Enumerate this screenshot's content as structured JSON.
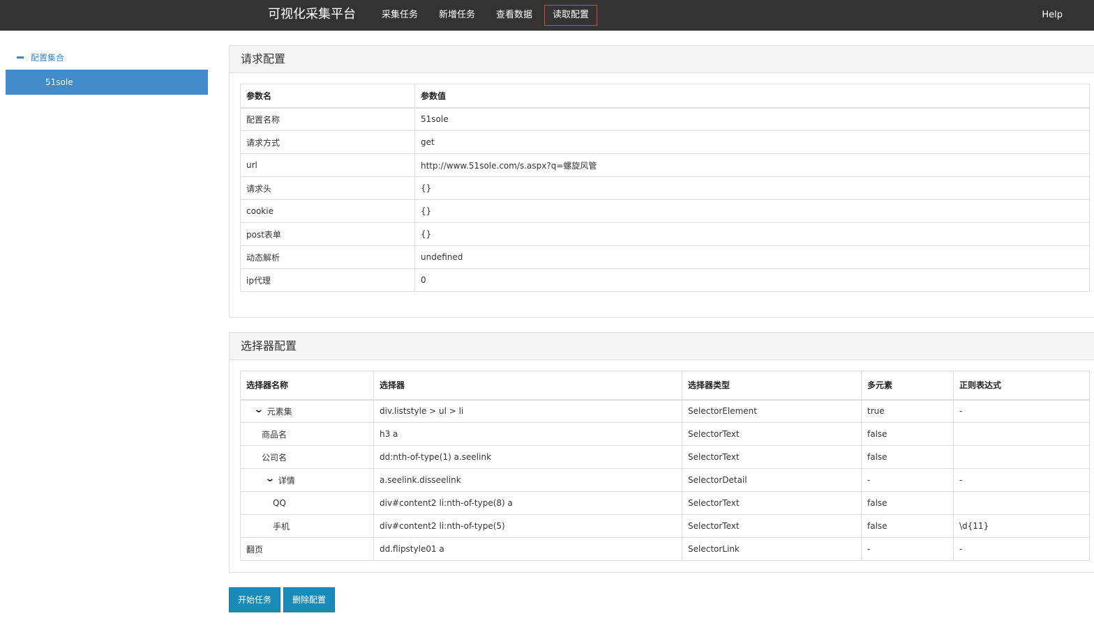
{
  "nav": {
    "brand": "可视化采集平台",
    "items": [
      {
        "label": "采集任务"
      },
      {
        "label": "新增任务"
      },
      {
        "label": "查看数据"
      },
      {
        "label": "读取配置"
      }
    ],
    "help": "Help",
    "active_border_color": "#e0433a"
  },
  "sidebar": {
    "root_label": "配置集合",
    "items": [
      {
        "label": "51sole"
      }
    ]
  },
  "request_panel": {
    "title": "请求配置",
    "headers": [
      "参数名",
      "参数值"
    ],
    "rows": [
      [
        "配置名称",
        "51sole"
      ],
      [
        "请求方式",
        "get"
      ],
      [
        "url",
        "http://www.51sole.com/s.aspx?q=螺旋风管"
      ],
      [
        "请求头",
        "{}"
      ],
      [
        "cookie",
        "{}"
      ],
      [
        "post表单",
        "{}"
      ],
      [
        "动态解析",
        "undefined"
      ],
      [
        "ip代理",
        "0"
      ]
    ]
  },
  "selector_panel": {
    "title": "选择器配置",
    "headers": [
      "选择器名称",
      "选择器",
      "选择器类型",
      "多元素",
      "正则表达式"
    ],
    "rows": [
      {
        "name": "元素集",
        "expandable": true,
        "selector": "div.liststyle > ul > li",
        "type": "SelectorElement",
        "multiple": "true",
        "regex": "-"
      },
      {
        "name": "商品名",
        "expandable": false,
        "selector": "h3 a",
        "type": "SelectorText",
        "multiple": "false",
        "regex": ""
      },
      {
        "name": "公司名",
        "expandable": false,
        "selector": "dd:nth-of-type(1) a.seelink",
        "type": "SelectorText",
        "multiple": "false",
        "regex": ""
      },
      {
        "name": "详情",
        "expandable": true,
        "selector": "a.seelink.disseelink",
        "type": "SelectorDetail",
        "multiple": "-",
        "regex": "-"
      },
      {
        "name": "QQ",
        "expandable": false,
        "selector": "div#content2 li:nth-of-type(8) a",
        "type": "SelectorText",
        "multiple": "false",
        "regex": ""
      },
      {
        "name": "手机",
        "expandable": false,
        "selector": "div#content2 li:nth-of-type(5)",
        "type": "SelectorText",
        "multiple": "false",
        "regex": "\\d{11}"
      },
      {
        "name": "翻页",
        "expandable": false,
        "selector": "dd.flipstyle01 a",
        "type": "SelectorLink",
        "multiple": "-",
        "regex": "-"
      }
    ]
  },
  "actions": {
    "start_label": "开始任务",
    "delete_label": "删除配置"
  },
  "colors": {
    "navbar_bg": "#333333",
    "sidebar_selected_bg": "#428bca",
    "link_blue": "#3a87c8",
    "button_bg": "#1a8bb9"
  }
}
